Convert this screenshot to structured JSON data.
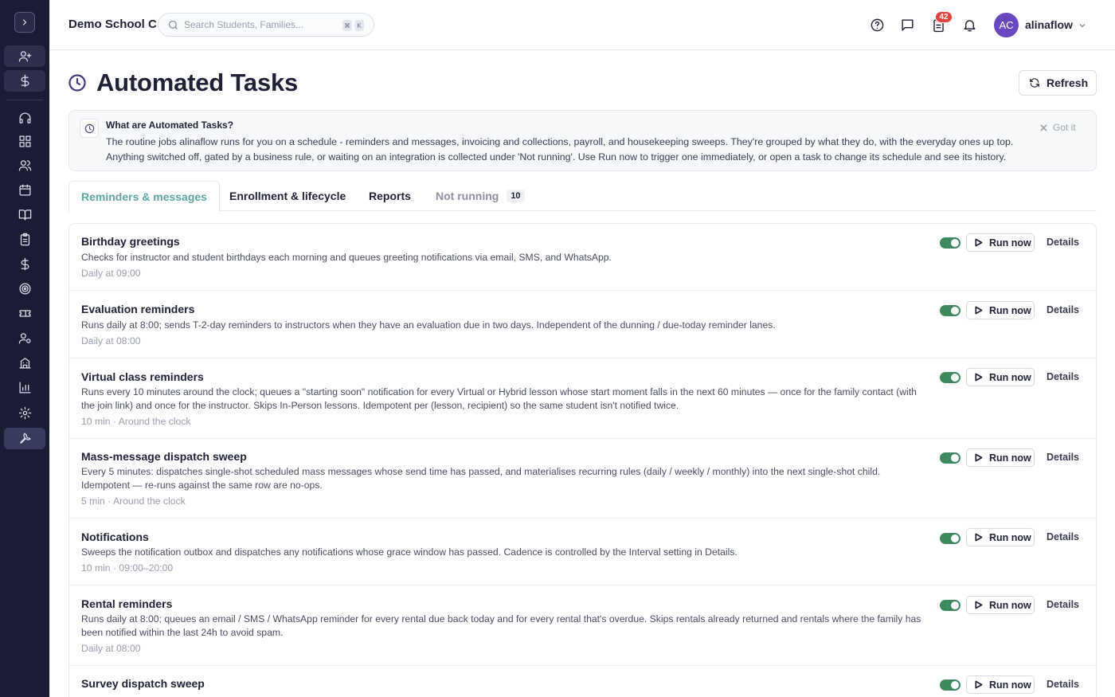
{
  "header": {
    "school_name": "Demo School C",
    "search_placeholder": "Search Students, Families...",
    "shortcut_keys": [
      "⌘",
      "K"
    ],
    "notification_count": "42",
    "user_initials": "AC",
    "username": "alinaflow"
  },
  "page": {
    "title": "Automated Tasks",
    "refresh_label": "Refresh"
  },
  "info": {
    "title": "What are Automated Tasks?",
    "body": "The routine jobs alinaflow runs for you on a schedule - reminders and messages, invoicing and collections, payroll, and housekeeping sweeps. They're grouped by what they do, with the everyday ones up top. Anything switched off, gated by a business rule, or waiting on an integration is collected under 'Not running'. Use Run now to trigger one immediately, or open a task to change its schedule and see its history.",
    "dismiss_label": "Got it"
  },
  "tabs": [
    {
      "label": "Reminders & messages",
      "active": true
    },
    {
      "label": "Enrollment & lifecycle"
    },
    {
      "label": "Reports"
    },
    {
      "label": "Not running",
      "count": "10"
    }
  ],
  "run_label": "Run now",
  "details_label": "Details",
  "tasks": [
    {
      "name": "Birthday greetings",
      "description": "Checks for instructor and student birthdays each morning and queues greeting notifications via email, SMS, and WhatsApp.",
      "schedule": "Daily at 09:00",
      "enabled": true
    },
    {
      "name": "Evaluation reminders",
      "description": "Runs daily at 8:00; sends T-2-day reminders to instructors when they have an evaluation due in two days. Independent of the dunning / due-today reminder lanes.",
      "schedule": "Daily at 08:00",
      "enabled": true
    },
    {
      "name": "Virtual class reminders",
      "description": "Runs every 10 minutes around the clock; queues a \"starting soon\" notification for every Virtual or Hybrid lesson whose start moment falls in the next 60 minutes — once for the family contact (with the join link) and once for the instructor. Skips In-Person lessons. Idempotent per (lesson, recipient) so the same student isn't notified twice.",
      "schedule": "10 min · Around the clock",
      "enabled": true
    },
    {
      "name": "Mass-message dispatch sweep",
      "description": "Every 5 minutes: dispatches single-shot scheduled mass messages whose send time has passed, and materialises recurring rules (daily / weekly / monthly) into the next single-shot child. Idempotent — re-runs against the same row are no-ops.",
      "schedule": "5 min · Around the clock",
      "enabled": true
    },
    {
      "name": "Notifications",
      "description": "Sweeps the notification outbox and dispatches any notifications whose grace window has passed. Cadence is controlled by the Interval setting in Details.",
      "schedule": "10 min · 09:00–20:00",
      "enabled": true
    },
    {
      "name": "Rental reminders",
      "description": "Runs daily at 8:00; queues an email / SMS / WhatsApp reminder for every rental due back today and for every rental that's overdue. Skips rentals already returned and rentals where the family has been notified within the last 24h to avoid spam.",
      "schedule": "Daily at 08:00",
      "enabled": true
    },
    {
      "name": "Survey dispatch sweep",
      "description": "",
      "schedule": "",
      "enabled": true
    }
  ]
}
